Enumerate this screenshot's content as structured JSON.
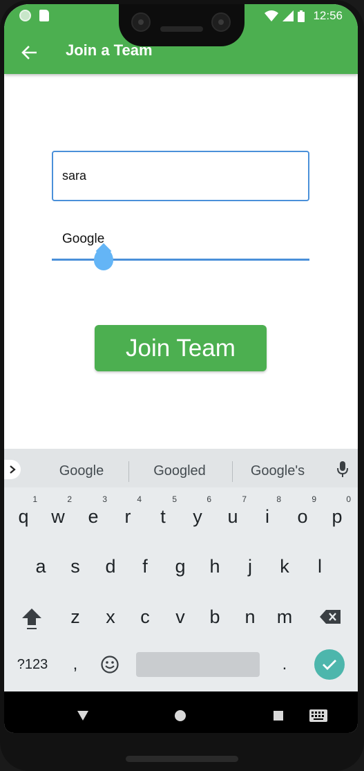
{
  "status_bar": {
    "time": "12:56",
    "icons_left": [
      "circle-icon",
      "sd-card-icon"
    ],
    "icons_right": [
      "wifi-icon",
      "signal-icon",
      "battery-icon"
    ]
  },
  "app_bar": {
    "title": "Join a Team",
    "back_icon": "arrow-left-icon",
    "color": "#4caf50"
  },
  "form": {
    "name_value": "sara",
    "slider_label": "Google",
    "slider_value_fraction": 0.2,
    "join_button_label": "Join Team",
    "accent_color": "#4a90d9"
  },
  "keyboard": {
    "suggestions": [
      "Google",
      "Googled",
      "Google's"
    ],
    "row1": [
      {
        "key": "q",
        "hint": "1"
      },
      {
        "key": "w",
        "hint": "2"
      },
      {
        "key": "e",
        "hint": "3"
      },
      {
        "key": "r",
        "hint": "4"
      },
      {
        "key": "t",
        "hint": "5"
      },
      {
        "key": "y",
        "hint": "6"
      },
      {
        "key": "u",
        "hint": "7"
      },
      {
        "key": "i",
        "hint": "8"
      },
      {
        "key": "o",
        "hint": "9"
      },
      {
        "key": "p",
        "hint": "0"
      }
    ],
    "row2": [
      "a",
      "s",
      "d",
      "f",
      "g",
      "h",
      "j",
      "k",
      "l"
    ],
    "row3": [
      "z",
      "x",
      "c",
      "v",
      "b",
      "n",
      "m"
    ],
    "symbols_label": "?123",
    "comma_label": ",",
    "period_label": ".",
    "enter_color": "#4db6ac"
  },
  "nav_bar": {
    "buttons": [
      "back-triangle-icon",
      "home-circle-icon",
      "recents-square-icon",
      "keyboard-switch-icon"
    ]
  }
}
